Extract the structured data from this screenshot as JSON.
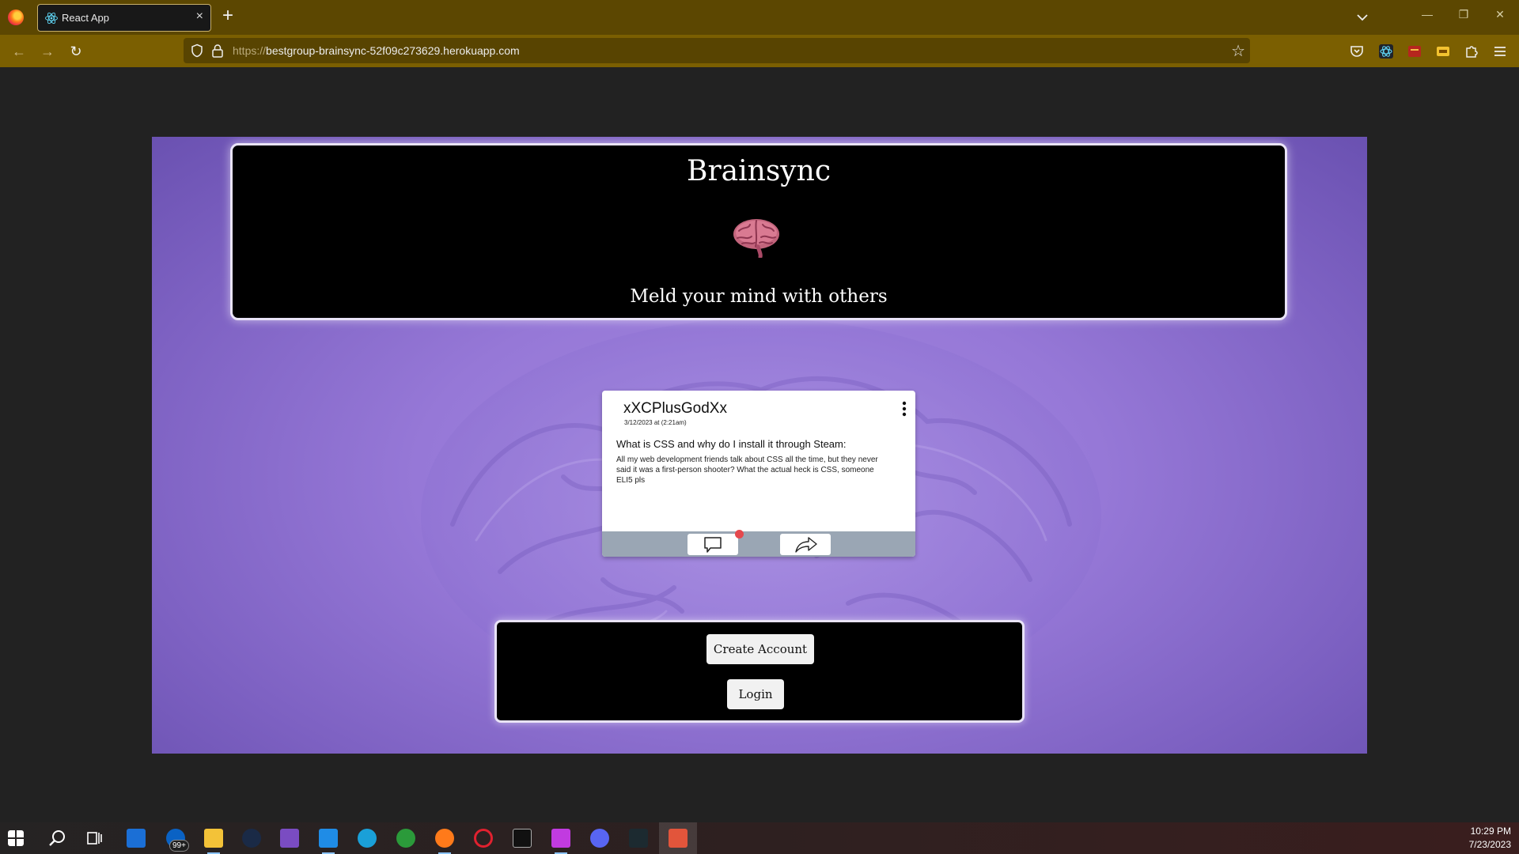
{
  "browser": {
    "tab_title": "React App",
    "url_protocol": "https://",
    "url_host": "bestgroup-brainsync-52f09c273629.herokuapp.com",
    "colors": {
      "tabbar": "#5c4701",
      "navbar": "#7b5f01"
    }
  },
  "header": {
    "title": "Brainsync",
    "tagline": "Meld your mind with others"
  },
  "post": {
    "username": "xXCPlusGodXx",
    "date": "3/12/2023 at (2:21am)",
    "question": "What is CSS and why do I install it through Steam:",
    "body": "All my web development friends talk about CSS all the time, but they never said it was a first-person shooter? What the actual heck is CSS, someone ELI5 pls"
  },
  "auth": {
    "create_account": "Create Account",
    "login": "Login"
  },
  "taskbar": {
    "mail_badge": "99+",
    "time": "10:29 PM",
    "date": "7/23/2023"
  },
  "colors": {
    "page_purple": "#9678d7",
    "box_black": "#000000",
    "notification_dot": "#e5484d"
  }
}
